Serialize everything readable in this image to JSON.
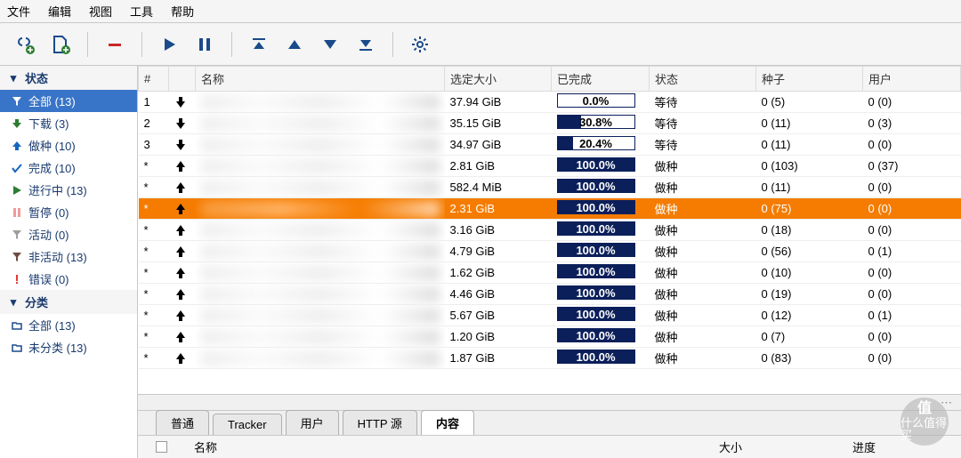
{
  "menu": {
    "file": "文件",
    "edit": "编辑",
    "view": "视图",
    "tools": "工具",
    "help": "帮助"
  },
  "sidebar": {
    "status_header": "状态",
    "status": [
      {
        "icon": "filter",
        "color": "#f57c00",
        "label": "全部 (13)",
        "sel": true
      },
      {
        "icon": "down",
        "color": "#2e7d32",
        "label": "下载 (3)"
      },
      {
        "icon": "up",
        "color": "#1565c0",
        "label": "做种 (10)"
      },
      {
        "icon": "check",
        "color": "#1565c0",
        "label": "完成 (10)"
      },
      {
        "icon": "play",
        "color": "#2e7d32",
        "label": "进行中 (13)"
      },
      {
        "icon": "pause",
        "color": "#ef9a9a",
        "label": "暂停 (0)"
      },
      {
        "icon": "filter",
        "color": "#9e9e9e",
        "label": "活动 (0)"
      },
      {
        "icon": "filter",
        "color": "#6d4c41",
        "label": "非活动 (13)"
      },
      {
        "icon": "bang",
        "color": "#e53935",
        "label": "错误 (0)"
      }
    ],
    "cat_header": "分类",
    "cats": [
      {
        "icon": "folder",
        "label": "全部 (13)"
      },
      {
        "icon": "folder",
        "label": "未分类 (13)"
      }
    ]
  },
  "columns": {
    "num": "#",
    "name": "名称",
    "size": "选定大小",
    "done": "已完成",
    "status": "状态",
    "seeds": "种子",
    "peers": "用户"
  },
  "rows": [
    {
      "n": "1",
      "dir": "dn",
      "size": "37.94 GiB",
      "pct": 0.0,
      "status": "等待",
      "seeds": "0 (5)",
      "peers": "0 (0)"
    },
    {
      "n": "2",
      "dir": "dn",
      "size": "35.15 GiB",
      "pct": 30.8,
      "status": "等待",
      "seeds": "0 (11)",
      "peers": "0 (3)"
    },
    {
      "n": "3",
      "dir": "dn",
      "size": "34.97 GiB",
      "pct": 20.4,
      "status": "等待",
      "seeds": "0 (11)",
      "peers": "0 (0)"
    },
    {
      "n": "*",
      "dir": "up",
      "size": "2.81 GiB",
      "pct": 100.0,
      "status": "做种",
      "seeds": "0 (103)",
      "peers": "0 (37)"
    },
    {
      "n": "*",
      "dir": "up",
      "size": "582.4 MiB",
      "pct": 100.0,
      "status": "做种",
      "seeds": "0 (11)",
      "peers": "0 (0)"
    },
    {
      "n": "*",
      "dir": "up",
      "size": "2.31 GiB",
      "pct": 100.0,
      "status": "做种",
      "seeds": "0 (75)",
      "peers": "0 (0)",
      "sel": true
    },
    {
      "n": "*",
      "dir": "up",
      "size": "3.16 GiB",
      "pct": 100.0,
      "status": "做种",
      "seeds": "0 (18)",
      "peers": "0 (0)"
    },
    {
      "n": "*",
      "dir": "up",
      "size": "4.79 GiB",
      "pct": 100.0,
      "status": "做种",
      "seeds": "0 (56)",
      "peers": "0 (1)"
    },
    {
      "n": "*",
      "dir": "up",
      "size": "1.62 GiB",
      "pct": 100.0,
      "status": "做种",
      "seeds": "0 (10)",
      "peers": "0 (0)"
    },
    {
      "n": "*",
      "dir": "up",
      "size": "4.46 GiB",
      "pct": 100.0,
      "status": "做种",
      "seeds": "0 (19)",
      "peers": "0 (0)"
    },
    {
      "n": "*",
      "dir": "up",
      "size": "5.67 GiB",
      "pct": 100.0,
      "status": "做种",
      "seeds": "0 (12)",
      "peers": "0 (1)"
    },
    {
      "n": "*",
      "dir": "up",
      "size": "1.20 GiB",
      "pct": 100.0,
      "status": "做种",
      "seeds": "0 (7)",
      "peers": "0 (0)"
    },
    {
      "n": "*",
      "dir": "up",
      "size": "1.87 GiB",
      "pct": 100.0,
      "status": "做种",
      "seeds": "0 (83)",
      "peers": "0 (0)"
    }
  ],
  "tabs": {
    "general": "普通",
    "tracker": "Tracker",
    "peers": "用户",
    "http": "HTTP 源",
    "content": "内容"
  },
  "content_cols": {
    "name": "名称",
    "size": "大小",
    "progress": "进度"
  },
  "watermark": {
    "top": "值",
    "bottom": "什么值得买"
  }
}
